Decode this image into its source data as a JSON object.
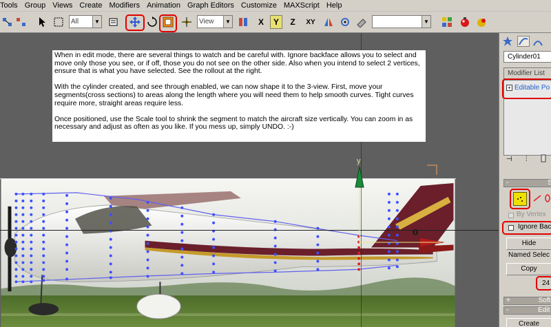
{
  "menu": [
    "Tools",
    "Group",
    "Views",
    "Create",
    "Modifiers",
    "Animation",
    "Graph Editors",
    "Customize",
    "MAXScript",
    "Help"
  ],
  "toolbar": {
    "selection_filter": "All",
    "reference_coord": "View",
    "icons": {
      "undo": "undo-arrow-icon",
      "select": "arrow-pointer-icon",
      "move": "move-arrows-icon",
      "scale": "scale-square-icon",
      "render": "teapot-icon"
    }
  },
  "viewport": {
    "instructions": [
      "When in edit mode, there are several things to watch and be careful with.  Ignore backface allows you to select and move only those you see, or if off, those you do not see on the other side.  Also when you intend to select 2 vertices, ensure that is what you have selected.  See the rollout at the right.",
      "With the cylinder created, and see through enabled, we can now shape it to the 3-view.  First, move your segments(cross sections) to areas along the length where you will need them to help smooth curves.  Tight curves require more, straight areas require less.",
      "Once positioned, use the Scale tool to shrink the segment to match the aircraft size vertically.  You can zoom in as necessary and adjust as often as you like.  If you mess up, simply UNDO. :-)"
    ],
    "axis_label": "y",
    "colors": {
      "vertex": "#3c50ff",
      "tail_livery": "#6a1f2a",
      "highlight": "#e00000"
    }
  },
  "command_panel": {
    "object_name": "Cylinder01",
    "modifier_list_label": "Modifier List",
    "stack_item": "Editable Po",
    "selection_rollout": "Se",
    "by_vertex": "By Vertex",
    "ignore_backfacing": "Ignore Bac",
    "hide_button": "Hide",
    "named_selections": "Named Selec",
    "copy_button": "Copy",
    "selected_count": "24",
    "soft_selection_rollout": "Soft",
    "edit_rollout": "Edit",
    "create_button": "Create"
  }
}
